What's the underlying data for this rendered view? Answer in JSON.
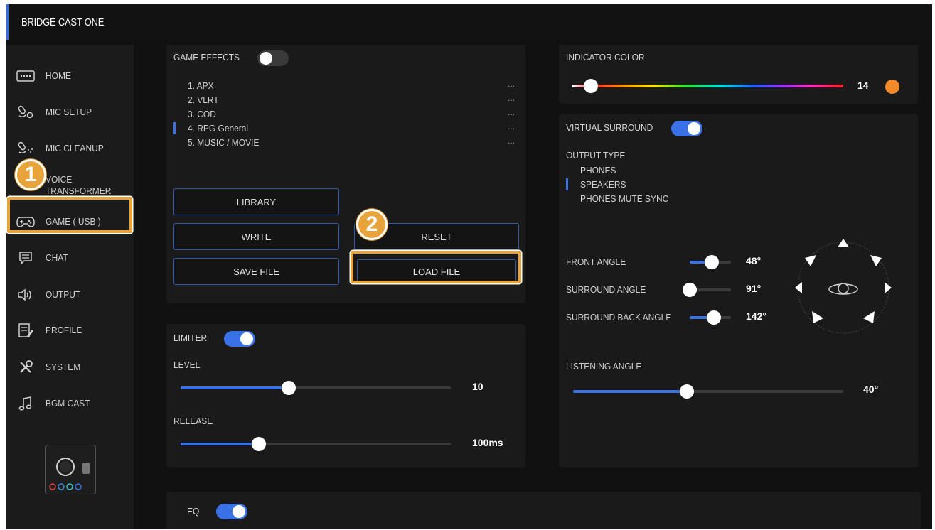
{
  "app": {
    "title": "BRIDGE CAST ONE"
  },
  "sidebar": {
    "items": [
      {
        "label": "HOME",
        "icon": "home-icon"
      },
      {
        "label": "MIC SETUP",
        "icon": "mic-setup-icon"
      },
      {
        "label": "MIC CLEANUP",
        "icon": "mic-cleanup-icon"
      },
      {
        "label": "VOICE TRANSFORMER",
        "icon": "voice-transformer-icon"
      },
      {
        "label": "GAME ( USB )",
        "icon": "gamepad-icon"
      },
      {
        "label": "CHAT",
        "icon": "chat-icon"
      },
      {
        "label": "OUTPUT",
        "icon": "speaker-icon"
      },
      {
        "label": "PROFILE",
        "icon": "profile-icon"
      },
      {
        "label": "SYSTEM",
        "icon": "wrench-icon"
      },
      {
        "label": "BGM CAST",
        "icon": "music-note-icon"
      }
    ]
  },
  "callouts": {
    "one": "1",
    "two": "2"
  },
  "game_effects": {
    "title": "GAME EFFECTS",
    "enabled": false,
    "presets": [
      {
        "label": "1. APX",
        "more": "..."
      },
      {
        "label": "2. VLRT",
        "more": "..."
      },
      {
        "label": "3. COD",
        "more": "..."
      },
      {
        "label": "4. RPG General",
        "more": "..."
      },
      {
        "label": "5. MUSIC / MOVIE",
        "more": "..."
      }
    ],
    "selected_index": 3,
    "buttons": {
      "library": "LIBRARY",
      "write": "WRITE",
      "reset": "RESET",
      "save_file": "SAVE FILE",
      "load_file": "LOAD FILE"
    }
  },
  "limiter": {
    "title": "LIMITER",
    "enabled": true,
    "level": {
      "label": "LEVEL",
      "value": "10",
      "fraction": 0.4
    },
    "release": {
      "label": "RELEASE",
      "value": "100ms",
      "fraction": 0.29
    }
  },
  "eq": {
    "title": "EQ",
    "enabled": true
  },
  "indicator_color": {
    "title": "INDICATOR COLOR",
    "value": "14",
    "fraction": 0.07,
    "swatch": "#f08a2a"
  },
  "virtual_surround": {
    "title": "VIRTUAL SURROUND",
    "enabled": true,
    "output_type_label": "OUTPUT TYPE",
    "output_types": [
      "PHONES",
      "SPEAKERS",
      "PHONES MUTE SYNC"
    ],
    "selected_output": 1,
    "front_angle": {
      "label": "FRONT ANGLE",
      "value": "48°",
      "fraction": 0.53
    },
    "surround_angle": {
      "label": "SURROUND ANGLE",
      "value": "91°",
      "fraction": 0.0
    },
    "surround_back_angle": {
      "label": "SURROUND BACK ANGLE",
      "value": "142°",
      "fraction": 0.58
    },
    "listening_angle": {
      "label": "LISTENING ANGLE",
      "value": "40°",
      "fraction": 0.42
    }
  },
  "colors": {
    "accent": "#3a72e6",
    "highlight": "#e8a33a",
    "background": "#111111",
    "panel": "#1a1a1a"
  }
}
